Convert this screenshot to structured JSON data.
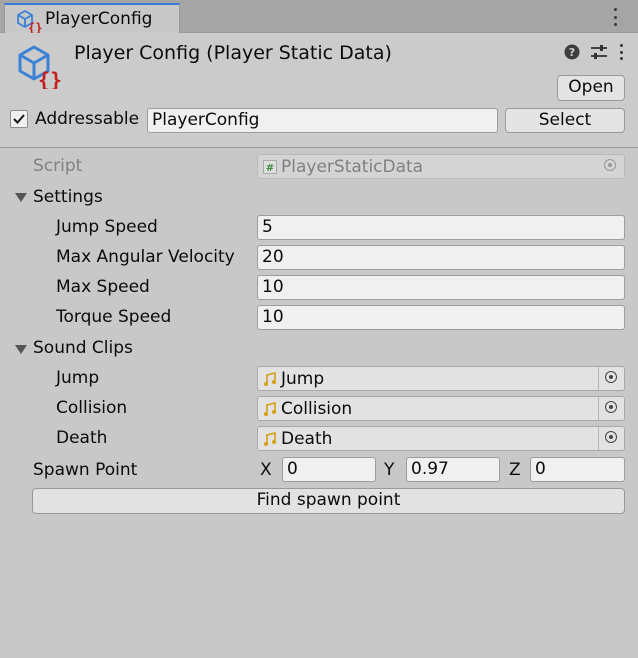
{
  "tab": {
    "label": "PlayerConfig"
  },
  "header": {
    "title": "Player Config (Player Static Data)",
    "open_label": "Open",
    "addressable_label": "Addressable",
    "addressable_checked": true,
    "address_value": "PlayerConfig",
    "select_label": "Select"
  },
  "script": {
    "label": "Script",
    "value": "PlayerStaticData"
  },
  "settings": {
    "label": "Settings",
    "fields": [
      {
        "label": "Jump Speed",
        "value": "5"
      },
      {
        "label": "Max Angular Velocity",
        "value": "20"
      },
      {
        "label": "Max Speed",
        "value": "10"
      },
      {
        "label": "Torque Speed",
        "value": "10"
      }
    ]
  },
  "sound_clips": {
    "label": "Sound Clips",
    "fields": [
      {
        "label": "Jump",
        "value": "Jump"
      },
      {
        "label": "Collision",
        "value": "Collision"
      },
      {
        "label": "Death",
        "value": "Death"
      }
    ]
  },
  "spawn_point": {
    "label": "Spawn Point",
    "x_label": "X",
    "x": "0",
    "y_label": "Y",
    "y": "0.97",
    "z_label": "Z",
    "z": "0"
  },
  "find_button": "Find spawn point",
  "colors": {
    "accent": "#3a79d6",
    "icon_blue": "#3b82d6",
    "icon_red": "#c0201e",
    "audio_icon": "#d4a017"
  }
}
